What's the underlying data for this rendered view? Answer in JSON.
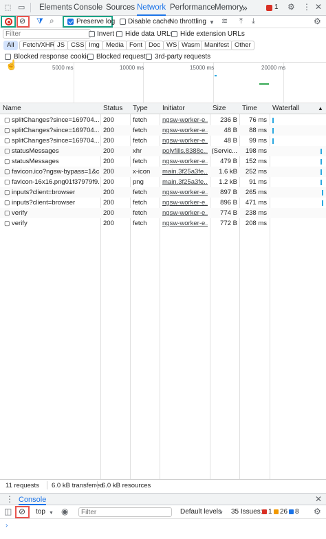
{
  "tabs": {
    "items": [
      "Elements",
      "Console",
      "Sources",
      "Network",
      "Performance",
      "Memory"
    ],
    "active": "Network",
    "more": "»",
    "error_count": "1"
  },
  "toolbar": {
    "preserve_log": "Preserve log",
    "disable_cache": "Disable cache",
    "throttling": "No throttling"
  },
  "filter": {
    "placeholder": "Filter",
    "invert": "Invert",
    "hide_data_urls": "Hide data URLs",
    "hide_extension_urls": "Hide extension URLs"
  },
  "types": [
    "All",
    "Fetch/XHR",
    "JS",
    "CSS",
    "Img",
    "Media",
    "Font",
    "Doc",
    "WS",
    "Wasm",
    "Manifest",
    "Other"
  ],
  "blocked": {
    "cookies": "Blocked response cookies",
    "requests": "Blocked requests",
    "third_party": "3rd-party requests"
  },
  "overview": {
    "ticks": [
      "5000 ms",
      "10000 ms",
      "15000 ms",
      "20000 ms"
    ]
  },
  "columns": [
    "Name",
    "Status",
    "Type",
    "Initiator",
    "Size",
    "Time",
    "Waterfall"
  ],
  "rows": [
    {
      "name": "splitChanges?since=169704...",
      "status": "200",
      "type": "fetch",
      "initiator": "ngsw-worker-e...",
      "size": "236 B",
      "time": "76 ms",
      "wf": 0.012
    },
    {
      "name": "splitChanges?since=169704...",
      "status": "200",
      "type": "fetch",
      "initiator": "ngsw-worker-e...",
      "size": "48 B",
      "time": "88 ms",
      "wf": 0.012
    },
    {
      "name": "splitChanges?since=169704...",
      "status": "200",
      "type": "fetch",
      "initiator": "ngsw-worker-e...",
      "size": "48 B",
      "time": "99 ms",
      "wf": 0.012
    },
    {
      "name": "statusMessages",
      "status": "200",
      "type": "xhr",
      "initiator": "polyfills.8388c...",
      "size": "(Servic...",
      "time": "198 ms",
      "wf": 0.96
    },
    {
      "name": "statusMessages",
      "status": "200",
      "type": "fetch",
      "initiator": "ngsw-worker-e...",
      "size": "479 B",
      "time": "152 ms",
      "wf": 0.96
    },
    {
      "name": "favicon.ico?ngsw-bypass=1&c...",
      "status": "200",
      "type": "x-icon",
      "initiator": "main.3f25a3fe...",
      "size": "1.6 kB",
      "time": "252 ms",
      "wf": 0.96
    },
    {
      "name": "favicon-16x16.png01f37979f9...",
      "status": "200",
      "type": "png",
      "initiator": "main.3f25a3fe...",
      "size": "1.2 kB",
      "time": "91 ms",
      "wf": 0.96
    },
    {
      "name": "inputs?client=browser",
      "status": "200",
      "type": "fetch",
      "initiator": "ngsw-worker-e...",
      "size": "897 B",
      "time": "265 ms",
      "wf": 0.99
    },
    {
      "name": "inputs?client=browser",
      "status": "200",
      "type": "fetch",
      "initiator": "ngsw-worker-e...",
      "size": "896 B",
      "time": "471 ms",
      "wf": 0.99
    },
    {
      "name": "verify",
      "status": "200",
      "type": "fetch",
      "initiator": "ngsw-worker-e...",
      "size": "774 B",
      "time": "238 ms",
      "wf": null
    },
    {
      "name": "verify",
      "status": "200",
      "type": "fetch",
      "initiator": "ngsw-worker-e...",
      "size": "772 B",
      "time": "208 ms",
      "wf": null
    }
  ],
  "summary": {
    "requests": "11 requests",
    "transferred": "6.0 kB transferred",
    "resources": "6.0 kB resources"
  },
  "drawer": {
    "tab": "Console",
    "context": "top",
    "filter_placeholder": "Filter",
    "levels": "Default levels",
    "issues": "35 Issues:",
    "issue_red": "1",
    "issue_orange": "26",
    "issue_blue": "8"
  },
  "colors": {
    "accent": "#1a73e8",
    "highlight_teal": "#1aa385",
    "highlight_red": "#e8554f",
    "waterfall": "#2aa8e0"
  }
}
